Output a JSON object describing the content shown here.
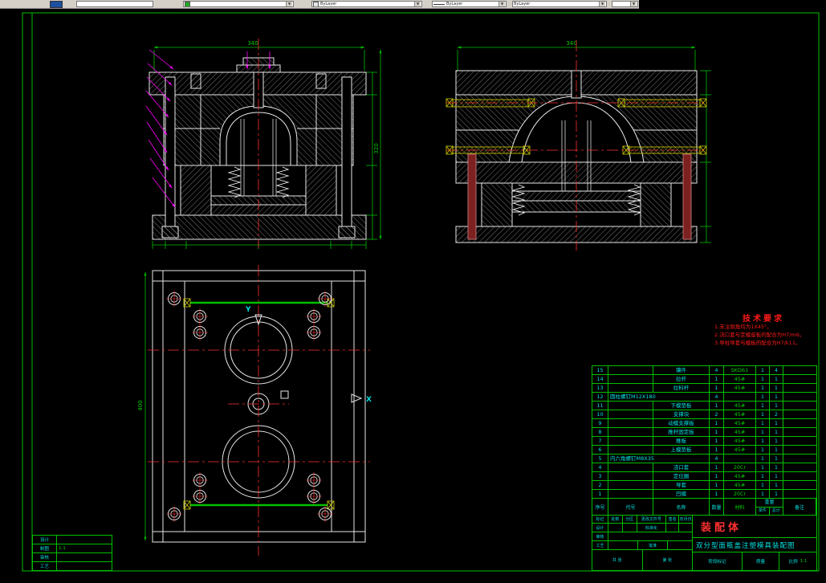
{
  "toolbar": {
    "color_value": "ByLayer",
    "linetype_value": "ByLayer",
    "lineweight_value": "ByLayer"
  },
  "drawing": {
    "dimensions": {
      "front_width": "340",
      "front_height": "320",
      "side_width": "340",
      "plan_height": "400"
    },
    "axes": {
      "x_label": "X",
      "y_label": "Y"
    },
    "tech_requirements": {
      "title": "技术要求",
      "items": [
        "1.未注倒角均为1X45°。",
        "2.浇口套与定模座板的配合为H7/m6。",
        "3.导柱导套与模板的配合为H7/k11。"
      ]
    },
    "parts_list": {
      "headers": {
        "seq": "序号",
        "code": "代号",
        "name": "名称",
        "qty": "数量",
        "material": "材料",
        "weight": "重量",
        "unit": "单件",
        "total": "总计",
        "remark": "备注"
      },
      "rows": [
        [
          "15",
          "",
          "镶件",
          "4",
          "SKD61",
          "1",
          "4",
          ""
        ],
        [
          "14",
          "",
          "拉杆",
          "1",
          "45#",
          "1",
          "1",
          ""
        ],
        [
          "13",
          "",
          "拉料杆",
          "1",
          "45#",
          "1",
          "1",
          ""
        ],
        [
          "12",
          "圆柱螺钉M12X180",
          "",
          "4",
          "",
          "1",
          "1",
          ""
        ],
        [
          "11",
          "",
          "下模垫板",
          "1",
          "45#",
          "1",
          "1",
          ""
        ],
        [
          "10",
          "",
          "支撑块",
          "2",
          "45#",
          "1",
          "2",
          ""
        ],
        [
          "9",
          "",
          "动模支撑板",
          "1",
          "45#",
          "1",
          "1",
          ""
        ],
        [
          "8",
          "",
          "推杆固定板",
          "1",
          "45#",
          "1",
          "1",
          ""
        ],
        [
          "7",
          "",
          "推板",
          "1",
          "45#",
          "1",
          "1",
          ""
        ],
        [
          "6",
          "",
          "上模垫板",
          "1",
          "45#",
          "1",
          "1",
          ""
        ],
        [
          "5",
          "内六角螺钉M8X35",
          "",
          "4",
          "",
          "1",
          "1",
          ""
        ],
        [
          "4",
          "",
          "浇口套",
          "1",
          "20Cr",
          "1",
          "1",
          ""
        ],
        [
          "3",
          "",
          "定位圈",
          "1",
          "45#",
          "1",
          "1",
          ""
        ],
        [
          "2",
          "",
          "导套",
          "1",
          "45#",
          "1",
          "1",
          ""
        ],
        [
          "1",
          "",
          "凹模",
          "1",
          "20Cr",
          "1",
          "1",
          ""
        ]
      ]
    },
    "title_block": {
      "labels": {
        "mark": "标记",
        "count": "处数",
        "zone": "分区",
        "change_doc": "更改文件号",
        "sign": "签名",
        "date": "年月日",
        "design": "设计",
        "standard": "标准化",
        "check": "审核",
        "process": "工艺",
        "approve": "批准",
        "stage": "阶段标记",
        "weight": "质量",
        "scale": "比例",
        "sheets": "共 张",
        "sheet_no": "第 张"
      },
      "part_name": "装配体",
      "drawing_title": "双分型面瓶盖注塑模具装配图",
      "scale_value": "1:1"
    },
    "corner_block": {
      "rows": [
        {
          "label": "设计",
          "value": ""
        },
        {
          "label": "制图",
          "value": "1:1"
        },
        {
          "label": "审核",
          "value": ""
        },
        {
          "label": "工艺",
          "value": ""
        }
      ]
    }
  }
}
